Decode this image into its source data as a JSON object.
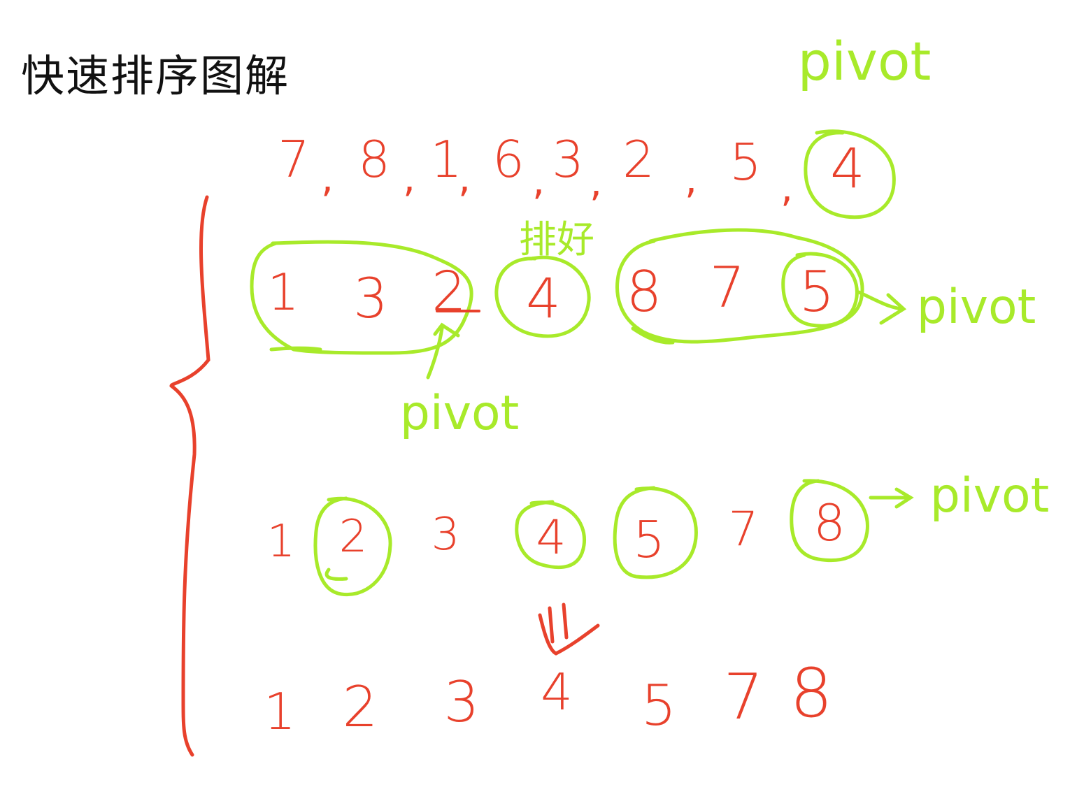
{
  "title": "快速排序图解",
  "labels": {
    "pivot_top": "pivot",
    "sorted_note": "排好",
    "pivot_row2_right": "pivot",
    "pivot_row2_below": "pivot",
    "pivot_row3_right": "pivot"
  },
  "rows": {
    "row1": {
      "numbers": [
        "7",
        "8",
        "1",
        "6",
        "3",
        "2",
        "5",
        "4"
      ],
      "separator": ","
    },
    "row2": {
      "numbers": [
        "1",
        "3",
        "2",
        "4",
        "8",
        "7",
        "5"
      ]
    },
    "row3": {
      "numbers": [
        "1",
        "2",
        "3",
        "4",
        "5",
        "7",
        "8"
      ]
    },
    "row4": {
      "numbers": [
        "1",
        "2",
        "3",
        "4",
        "5",
        "7",
        "8"
      ]
    }
  },
  "colors": {
    "ink_red": "#e8412c",
    "highlight_green": "#a8ea2a",
    "title_black": "#111111"
  }
}
